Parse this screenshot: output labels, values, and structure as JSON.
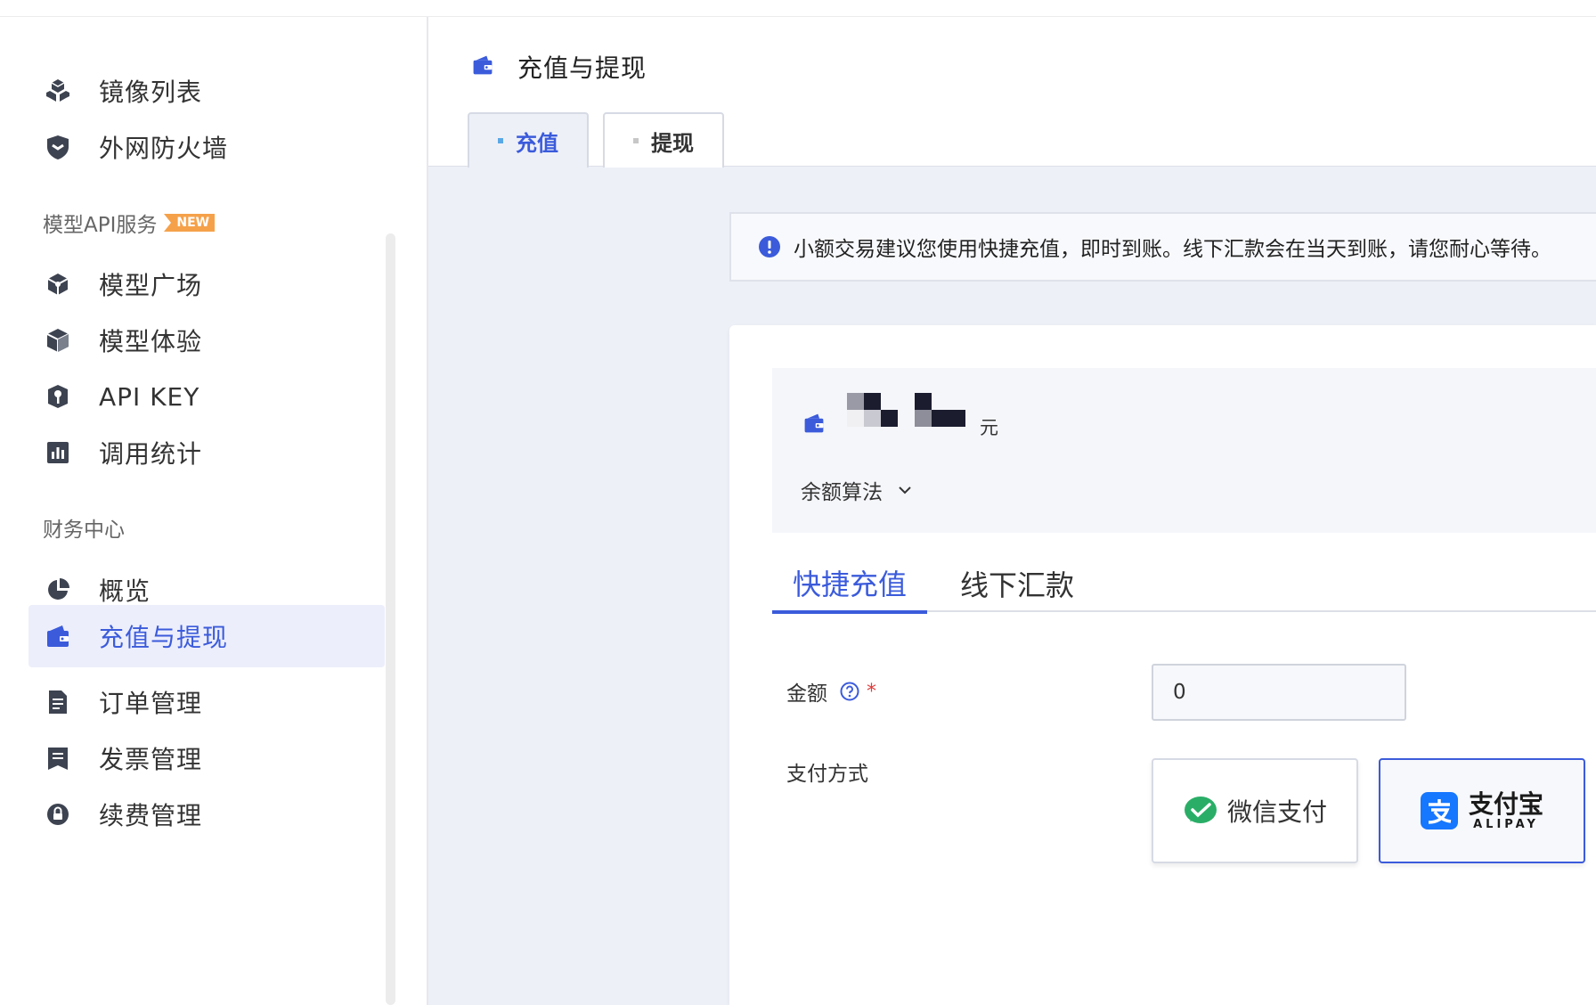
{
  "sidebar": {
    "items_top": [
      {
        "label": "镜像列表",
        "icon": "cubes-icon"
      },
      {
        "label": "外网防火墙",
        "icon": "shield-icon"
      }
    ],
    "section_model": {
      "title": "模型API服务",
      "badge": "NEW"
    },
    "items_model": [
      {
        "label": "模型广场",
        "icon": "model-square-icon"
      },
      {
        "label": "模型体验",
        "icon": "cube-icon"
      },
      {
        "label": "API KEY",
        "icon": "key-shield-icon"
      },
      {
        "label": "调用统计",
        "icon": "bar-chart-icon"
      }
    ],
    "section_finance": {
      "title": "财务中心"
    },
    "items_finance": [
      {
        "label": "概览",
        "icon": "pie-chart-icon"
      },
      {
        "label": "充值与提现",
        "icon": "wallet-icon",
        "active": true
      },
      {
        "label": "订单管理",
        "icon": "document-icon"
      },
      {
        "label": "发票管理",
        "icon": "invoice-icon"
      },
      {
        "label": "续费管理",
        "icon": "renew-icon"
      }
    ]
  },
  "header": {
    "title": "充值与提现",
    "tabs": [
      {
        "label": "充值",
        "active": true
      },
      {
        "label": "提现",
        "active": false
      }
    ]
  },
  "notice": {
    "text": "小额交易建议您使用快捷充值，即时到账。线下汇款会在当天到账，请您耐心等待。"
  },
  "balance": {
    "unit": "元",
    "algo_label": "余额算法"
  },
  "recharge_tabs": [
    {
      "label": "快捷充值",
      "active": true
    },
    {
      "label": "线下汇款",
      "active": false
    }
  ],
  "form": {
    "amount_label": "金额",
    "amount_required": "*",
    "amount_value": "0",
    "payment_label": "支付方式",
    "wechat_label": "微信支付",
    "alipay_label": "支付宝",
    "alipay_sub": "ALIPAY",
    "selected_method": "alipay"
  },
  "colors": {
    "accent": "#3b5bdb",
    "wechat": "#2aae67",
    "alipay": "#1677ff",
    "badge": "#f5a14a"
  }
}
